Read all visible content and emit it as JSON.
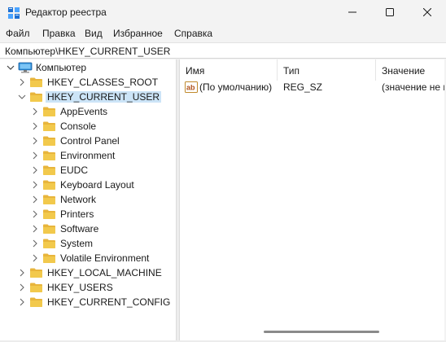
{
  "window": {
    "title": "Редактор реестра",
    "icon": "registry-editor-icon",
    "controls": {
      "minimize": "minimize-icon",
      "maximize": "maximize-icon",
      "close": "close-icon"
    }
  },
  "menu": {
    "items": [
      "Файл",
      "Правка",
      "Вид",
      "Избранное",
      "Справка"
    ]
  },
  "address": {
    "path": "Компьютер\\HKEY_CURRENT_USER"
  },
  "tree": {
    "root": "Компьютер",
    "items": [
      {
        "label": "HKEY_CLASSES_ROOT",
        "level": 1,
        "expanded": false
      },
      {
        "label": "HKEY_CURRENT_USER",
        "level": 1,
        "expanded": true,
        "selected": true
      },
      {
        "label": "AppEvents",
        "level": 2,
        "expanded": false
      },
      {
        "label": "Console",
        "level": 2,
        "expanded": false
      },
      {
        "label": "Control Panel",
        "level": 2,
        "expanded": false
      },
      {
        "label": "Environment",
        "level": 2,
        "expanded": false
      },
      {
        "label": "EUDC",
        "level": 2,
        "expanded": false
      },
      {
        "label": "Keyboard Layout",
        "level": 2,
        "expanded": false
      },
      {
        "label": "Network",
        "level": 2,
        "expanded": false
      },
      {
        "label": "Printers",
        "level": 2,
        "expanded": false
      },
      {
        "label": "Software",
        "level": 2,
        "expanded": false
      },
      {
        "label": "System",
        "level": 2,
        "expanded": false
      },
      {
        "label": "Volatile Environment",
        "level": 2,
        "expanded": false
      },
      {
        "label": "HKEY_LOCAL_MACHINE",
        "level": 1,
        "expanded": false
      },
      {
        "label": "HKEY_USERS",
        "level": 1,
        "expanded": false
      },
      {
        "label": "HKEY_CURRENT_CONFIG",
        "level": 1,
        "expanded": false
      }
    ]
  },
  "list": {
    "columns": [
      "Имя",
      "Тип",
      "Значение"
    ],
    "rows": [
      {
        "icon": "string-value-icon",
        "name": "(По умолчанию)",
        "type": "REG_SZ",
        "value": "(значение не присвоено)"
      }
    ]
  },
  "colors": {
    "selection": "#cce4f7",
    "folder": "#f2c94c",
    "accent": "#0078d4"
  }
}
